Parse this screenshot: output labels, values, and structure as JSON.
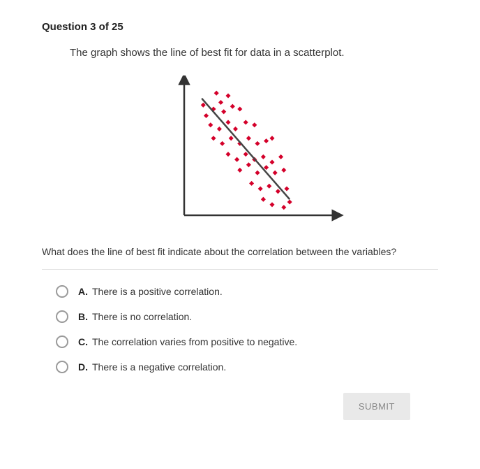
{
  "header": "Question 3 of 25",
  "intro": "The graph shows the line of best fit for data in a scatterplot.",
  "followup": "What does the line of best fit indicate about the correlation between the variables?",
  "options": [
    {
      "letter": "A.",
      "text": "There is a positive correlation."
    },
    {
      "letter": "B.",
      "text": "There is no correlation."
    },
    {
      "letter": "C.",
      "text": "The correlation varies from positive to negative."
    },
    {
      "letter": "D.",
      "text": "There is a negative correlation."
    }
  ],
  "submit_label": "SUBMIT",
  "chart_data": {
    "type": "scatter",
    "title": "",
    "xlabel": "",
    "ylabel": "",
    "xlim": [
      0,
      10
    ],
    "ylim": [
      0,
      10
    ],
    "series": [
      {
        "name": "data-points",
        "points": [
          [
            1.3,
            8.3
          ],
          [
            2.2,
            9.2
          ],
          [
            2.0,
            8.0
          ],
          [
            2.5,
            8.5
          ],
          [
            3.0,
            9.0
          ],
          [
            1.5,
            7.5
          ],
          [
            2.7,
            7.8
          ],
          [
            3.3,
            8.2
          ],
          [
            3.8,
            8.0
          ],
          [
            1.8,
            6.8
          ],
          [
            2.4,
            6.5
          ],
          [
            3.0,
            7.0
          ],
          [
            3.5,
            6.5
          ],
          [
            4.2,
            7.0
          ],
          [
            4.8,
            6.8
          ],
          [
            2.0,
            5.8
          ],
          [
            2.6,
            5.4
          ],
          [
            3.2,
            5.8
          ],
          [
            3.8,
            5.4
          ],
          [
            4.4,
            5.8
          ],
          [
            5.0,
            5.4
          ],
          [
            5.6,
            5.6
          ],
          [
            6.0,
            5.8
          ],
          [
            3.0,
            4.6
          ],
          [
            3.6,
            4.2
          ],
          [
            4.2,
            4.6
          ],
          [
            4.8,
            4.2
          ],
          [
            5.4,
            4.4
          ],
          [
            6.0,
            4.0
          ],
          [
            6.6,
            4.4
          ],
          [
            3.8,
            3.4
          ],
          [
            4.4,
            3.8
          ],
          [
            5.0,
            3.2
          ],
          [
            5.6,
            3.6
          ],
          [
            6.2,
            3.2
          ],
          [
            6.8,
            3.4
          ],
          [
            4.6,
            2.4
          ],
          [
            5.2,
            2.0
          ],
          [
            5.8,
            2.2
          ],
          [
            6.4,
            1.8
          ],
          [
            7.0,
            2.0
          ],
          [
            5.4,
            1.2
          ],
          [
            6.0,
            0.8
          ],
          [
            6.8,
            0.6
          ],
          [
            7.2,
            1.0
          ]
        ]
      },
      {
        "name": "best-fit-line",
        "type": "line",
        "points": [
          [
            1.2,
            8.8
          ],
          [
            7.2,
            1.2
          ]
        ]
      }
    ]
  }
}
